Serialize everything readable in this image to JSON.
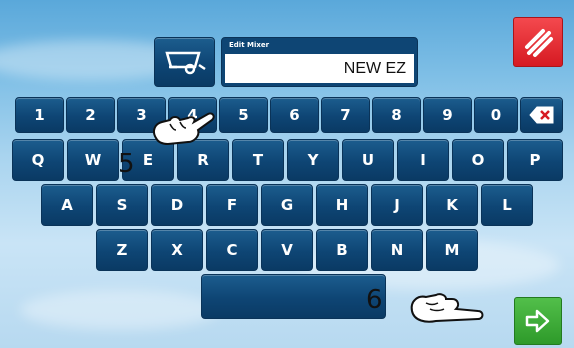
{
  "edit": {
    "label": "Edit Mixer",
    "value": "NEW EZ"
  },
  "keyboard": {
    "row_numbers": [
      "1",
      "2",
      "3",
      "4",
      "5",
      "6",
      "7",
      "8",
      "9",
      "0"
    ],
    "row_q": [
      "Q",
      "W",
      "E",
      "R",
      "T",
      "Y",
      "U",
      "I",
      "O",
      "P"
    ],
    "row_a": [
      "A",
      "S",
      "D",
      "F",
      "G",
      "H",
      "J",
      "K",
      "L"
    ],
    "row_z": [
      "Z",
      "X",
      "C",
      "V",
      "B",
      "N",
      "M"
    ],
    "backspace_icon": "backspace-icon",
    "space_label": ""
  },
  "buttons": {
    "mixer_icon": "mixer-wagon-icon",
    "cancel_icon": "slash-cancel-icon",
    "enter_icon": "enter-arrow-icon"
  },
  "annotations": {
    "step_a": "5",
    "step_b": "6"
  },
  "colors": {
    "key": "#0e4574",
    "cancel": "#d61a22",
    "enter": "#2e9a2a"
  }
}
